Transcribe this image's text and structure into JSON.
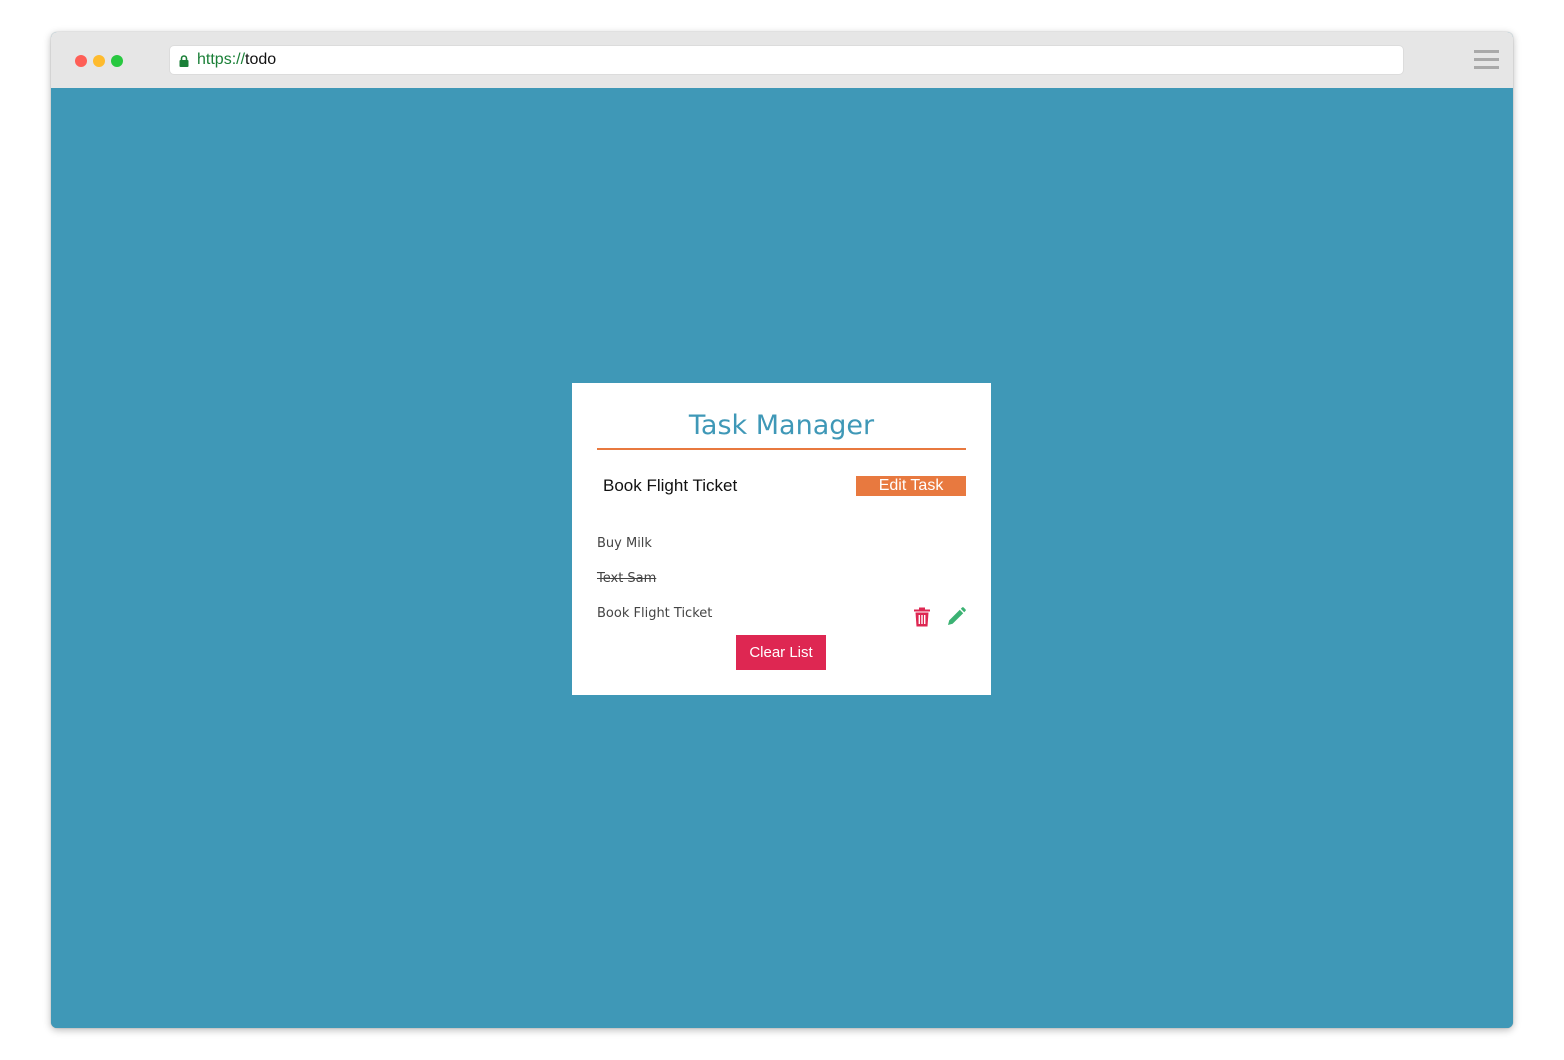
{
  "browser": {
    "url_scheme": "https://",
    "url_host": "todo",
    "icons": {
      "lock": "lock-icon",
      "menu": "hamburger-menu-icon"
    }
  },
  "colors": {
    "background": "#3f98b7",
    "accent_orange": "#e8793f",
    "danger_red": "#de2752",
    "edit_green": "#3bb273"
  },
  "app": {
    "title": "Task Manager",
    "input": {
      "value": "Book Flight Ticket"
    },
    "edit_button_label": "Edit Task",
    "tasks": [
      {
        "text": "Buy Milk",
        "completed": false
      },
      {
        "text": "Text Sam",
        "completed": true
      },
      {
        "text": "Book Flight Ticket",
        "completed": false,
        "icons": [
          "trash-icon",
          "pencil-icon"
        ]
      }
    ],
    "clear_button_label": "Clear List"
  }
}
